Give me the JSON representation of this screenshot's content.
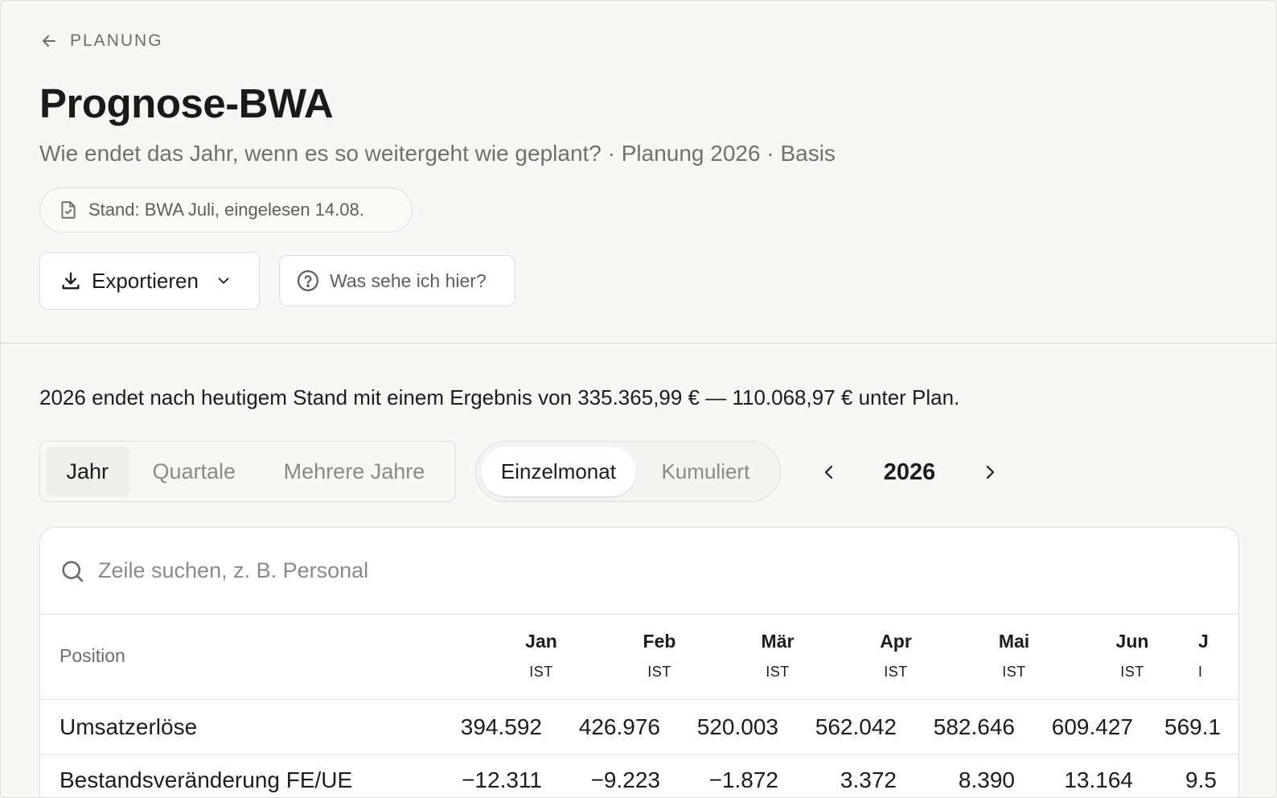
{
  "header": {
    "back_label": "PLANUNG",
    "title": "Prognose-BWA",
    "subtitle": "Wie endet das Jahr, wenn es so weitergeht wie geplant? · Planung 2026 · Basis",
    "stand": "Stand: BWA Juli, eingelesen 14.08.",
    "export_label": "Exportieren",
    "help_label": "Was sehe ich hier?"
  },
  "summary": "2026 endet nach heutigem Stand mit einem Ergebnis von 335.365,99 € — 110.068,97 € unter Plan.",
  "period_tabs": [
    "Jahr",
    "Quartale",
    "Mehrere Jahre"
  ],
  "mode_tabs": [
    "Einzelmonat",
    "Kumuliert"
  ],
  "year": "2026",
  "search": {
    "placeholder": "Zeile suchen, z. B. Personal"
  },
  "table": {
    "position_label": "Position",
    "columns": [
      {
        "month": "Jan",
        "type": "IST"
      },
      {
        "month": "Feb",
        "type": "IST"
      },
      {
        "month": "Mär",
        "type": "IST"
      },
      {
        "month": "Apr",
        "type": "IST"
      },
      {
        "month": "Mai",
        "type": "IST"
      },
      {
        "month": "Jun",
        "type": "IST"
      },
      {
        "month": "J",
        "type": "I"
      }
    ],
    "rows": [
      {
        "position": "Umsatzerlöse",
        "values": [
          "394.592",
          "426.976",
          "520.003",
          "562.042",
          "582.646",
          "609.427",
          "569.1"
        ]
      },
      {
        "position": "Bestandsveränderung FE/UE",
        "values": [
          "−12.311",
          "−9.223",
          "−1.872",
          "3.372",
          "8.390",
          "13.164",
          "9.5"
        ]
      }
    ]
  },
  "icons": {
    "back": "arrow-left-icon",
    "stand": "file-check-icon",
    "export": "download-icon",
    "export_menu": "chevron-down-icon",
    "help": "help-circle-icon",
    "prev_year": "chevron-left-icon",
    "next_year": "chevron-right-icon",
    "search": "search-icon"
  }
}
